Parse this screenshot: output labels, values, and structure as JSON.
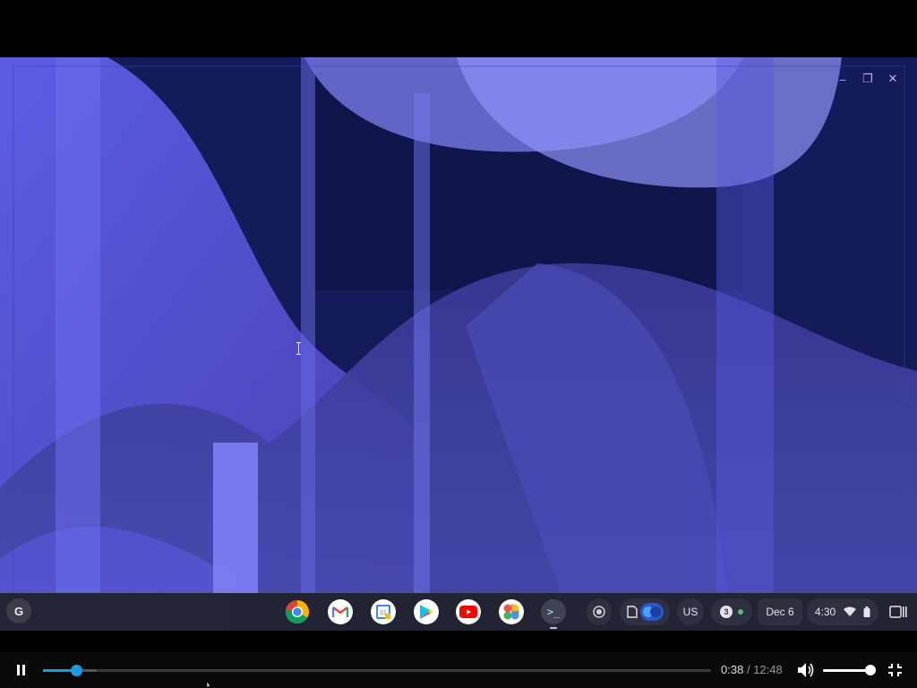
{
  "shelf": {
    "launcher_label": "G",
    "apps": [
      {
        "name": "Chrome",
        "icon": "chrome-icon"
      },
      {
        "name": "Gmail",
        "icon": "gmail-icon"
      },
      {
        "name": "Google Calendar",
        "icon": "calendar-icon",
        "label": "31"
      },
      {
        "name": "Google Play Store",
        "icon": "play-store-icon"
      },
      {
        "name": "YouTube",
        "icon": "youtube-icon"
      },
      {
        "name": "Google Photos",
        "icon": "photos-icon"
      },
      {
        "name": "Terminal",
        "icon": "terminal-icon",
        "label": ">_",
        "active": true
      }
    ],
    "tray": {
      "keyboard_layout": "US",
      "notification_count": "3",
      "date": "Dec 6",
      "time": "4:30"
    }
  },
  "player": {
    "current_time": "0:38",
    "separator": "/",
    "total_time": "12:48",
    "progress": 0.05,
    "buffered": 0.08,
    "volume": 1.0
  },
  "colors": {
    "accent": "#1a9be0",
    "shelf_bg": "#20212c",
    "wallpaper_dark": "#131a56",
    "wallpaper_light": "#6c6ff0"
  }
}
